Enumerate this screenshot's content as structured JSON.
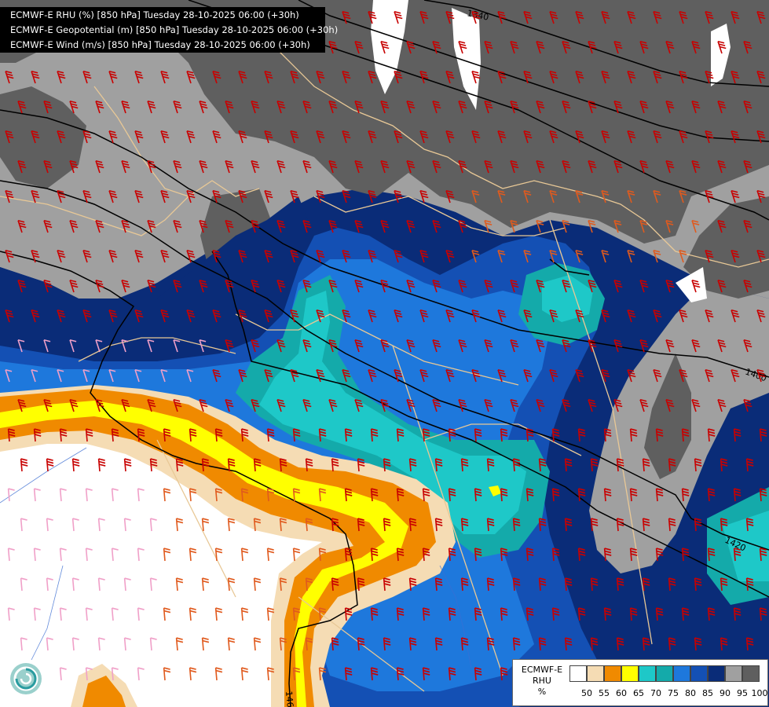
{
  "header": {
    "lines": [
      "ECMWF-E RHU (%) [850 hPa] Tuesday 28-10-2025 06:00 (+30h)",
      "ECMWF-E Geopotential (m) [850 hPa] Tuesday 28-10-2025 06:00 (+30h)",
      "ECMWF-E Wind (m/s) [850 hPa] Tuesday 28-10-2025 06:00 (+30h)"
    ]
  },
  "contour_labels": [
    "1340",
    "1400",
    "1420",
    "1460"
  ],
  "legend": {
    "model": "ECMWF-E",
    "variable": "RHU",
    "unit": "%",
    "ticks": [
      "50",
      "55",
      "60",
      "65",
      "70",
      "75",
      "80",
      "85",
      "90",
      "95",
      "100"
    ],
    "colors": [
      "#ffffff",
      "#f5dcb4",
      "#f08a00",
      "#ffff00",
      "#1ec8c8",
      "#14aaaa",
      "#1e78dc",
      "#1450b4",
      "#0a2c78",
      "#a0a0a0",
      "#5f5f5f"
    ]
  },
  "colors": {
    "dark_gray": "#5f5f5f",
    "light_gray": "#a0a0a0",
    "navy": "#0a2c78",
    "dark_blue": "#1450b4",
    "blue": "#1e78dc",
    "teal": "#14aaaa",
    "cyan": "#1ec8c8",
    "yellow": "#ffff00",
    "orange": "#f08a00",
    "peach": "#f5dcb4",
    "border": "#e8c896",
    "geopotential": "#000000",
    "wind_strong": "#c80000",
    "wind_medium": "#e05a1e",
    "wind_light": "#f0a0c8"
  },
  "icons": [
    "ecmwf-logo-icon"
  ]
}
